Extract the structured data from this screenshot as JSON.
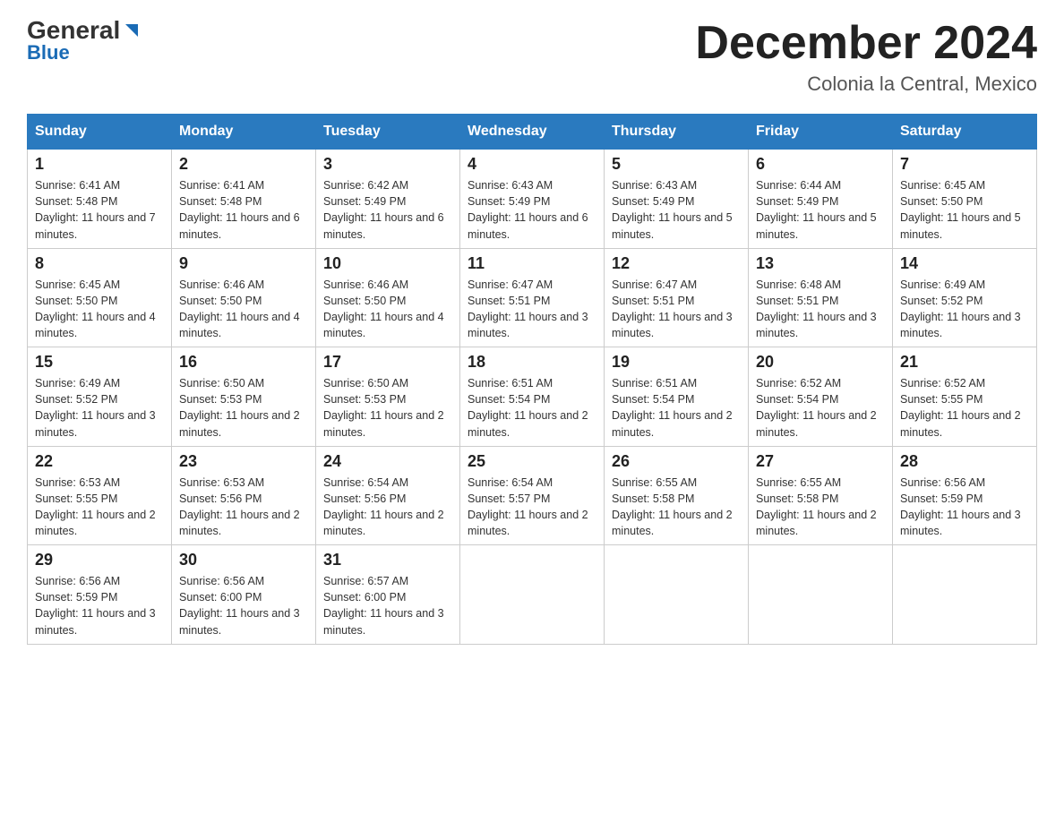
{
  "logo": {
    "general": "General",
    "blue": "Blue",
    "triangle_desc": "blue triangle icon"
  },
  "header": {
    "month_year": "December 2024",
    "location": "Colonia la Central, Mexico"
  },
  "days_of_week": [
    "Sunday",
    "Monday",
    "Tuesday",
    "Wednesday",
    "Thursday",
    "Friday",
    "Saturday"
  ],
  "weeks": [
    [
      {
        "day": "1",
        "sunrise": "6:41 AM",
        "sunset": "5:48 PM",
        "daylight": "11 hours and 7 minutes."
      },
      {
        "day": "2",
        "sunrise": "6:41 AM",
        "sunset": "5:48 PM",
        "daylight": "11 hours and 6 minutes."
      },
      {
        "day": "3",
        "sunrise": "6:42 AM",
        "sunset": "5:49 PM",
        "daylight": "11 hours and 6 minutes."
      },
      {
        "day": "4",
        "sunrise": "6:43 AM",
        "sunset": "5:49 PM",
        "daylight": "11 hours and 6 minutes."
      },
      {
        "day": "5",
        "sunrise": "6:43 AM",
        "sunset": "5:49 PM",
        "daylight": "11 hours and 5 minutes."
      },
      {
        "day": "6",
        "sunrise": "6:44 AM",
        "sunset": "5:49 PM",
        "daylight": "11 hours and 5 minutes."
      },
      {
        "day": "7",
        "sunrise": "6:45 AM",
        "sunset": "5:50 PM",
        "daylight": "11 hours and 5 minutes."
      }
    ],
    [
      {
        "day": "8",
        "sunrise": "6:45 AM",
        "sunset": "5:50 PM",
        "daylight": "11 hours and 4 minutes."
      },
      {
        "day": "9",
        "sunrise": "6:46 AM",
        "sunset": "5:50 PM",
        "daylight": "11 hours and 4 minutes."
      },
      {
        "day": "10",
        "sunrise": "6:46 AM",
        "sunset": "5:50 PM",
        "daylight": "11 hours and 4 minutes."
      },
      {
        "day": "11",
        "sunrise": "6:47 AM",
        "sunset": "5:51 PM",
        "daylight": "11 hours and 3 minutes."
      },
      {
        "day": "12",
        "sunrise": "6:47 AM",
        "sunset": "5:51 PM",
        "daylight": "11 hours and 3 minutes."
      },
      {
        "day": "13",
        "sunrise": "6:48 AM",
        "sunset": "5:51 PM",
        "daylight": "11 hours and 3 minutes."
      },
      {
        "day": "14",
        "sunrise": "6:49 AM",
        "sunset": "5:52 PM",
        "daylight": "11 hours and 3 minutes."
      }
    ],
    [
      {
        "day": "15",
        "sunrise": "6:49 AM",
        "sunset": "5:52 PM",
        "daylight": "11 hours and 3 minutes."
      },
      {
        "day": "16",
        "sunrise": "6:50 AM",
        "sunset": "5:53 PM",
        "daylight": "11 hours and 2 minutes."
      },
      {
        "day": "17",
        "sunrise": "6:50 AM",
        "sunset": "5:53 PM",
        "daylight": "11 hours and 2 minutes."
      },
      {
        "day": "18",
        "sunrise": "6:51 AM",
        "sunset": "5:54 PM",
        "daylight": "11 hours and 2 minutes."
      },
      {
        "day": "19",
        "sunrise": "6:51 AM",
        "sunset": "5:54 PM",
        "daylight": "11 hours and 2 minutes."
      },
      {
        "day": "20",
        "sunrise": "6:52 AM",
        "sunset": "5:54 PM",
        "daylight": "11 hours and 2 minutes."
      },
      {
        "day": "21",
        "sunrise": "6:52 AM",
        "sunset": "5:55 PM",
        "daylight": "11 hours and 2 minutes."
      }
    ],
    [
      {
        "day": "22",
        "sunrise": "6:53 AM",
        "sunset": "5:55 PM",
        "daylight": "11 hours and 2 minutes."
      },
      {
        "day": "23",
        "sunrise": "6:53 AM",
        "sunset": "5:56 PM",
        "daylight": "11 hours and 2 minutes."
      },
      {
        "day": "24",
        "sunrise": "6:54 AM",
        "sunset": "5:56 PM",
        "daylight": "11 hours and 2 minutes."
      },
      {
        "day": "25",
        "sunrise": "6:54 AM",
        "sunset": "5:57 PM",
        "daylight": "11 hours and 2 minutes."
      },
      {
        "day": "26",
        "sunrise": "6:55 AM",
        "sunset": "5:58 PM",
        "daylight": "11 hours and 2 minutes."
      },
      {
        "day": "27",
        "sunrise": "6:55 AM",
        "sunset": "5:58 PM",
        "daylight": "11 hours and 2 minutes."
      },
      {
        "day": "28",
        "sunrise": "6:56 AM",
        "sunset": "5:59 PM",
        "daylight": "11 hours and 3 minutes."
      }
    ],
    [
      {
        "day": "29",
        "sunrise": "6:56 AM",
        "sunset": "5:59 PM",
        "daylight": "11 hours and 3 minutes."
      },
      {
        "day": "30",
        "sunrise": "6:56 AM",
        "sunset": "6:00 PM",
        "daylight": "11 hours and 3 minutes."
      },
      {
        "day": "31",
        "sunrise": "6:57 AM",
        "sunset": "6:00 PM",
        "daylight": "11 hours and 3 minutes."
      },
      null,
      null,
      null,
      null
    ]
  ]
}
